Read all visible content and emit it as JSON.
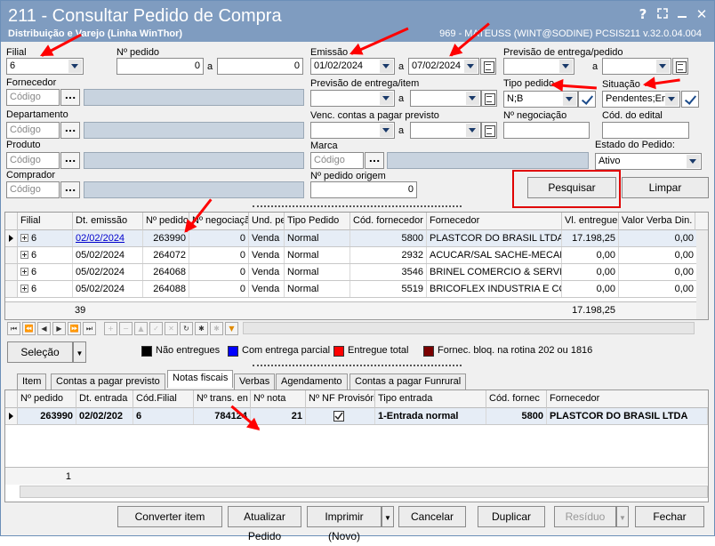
{
  "window": {
    "title": "211 - Consultar Pedido de Compra",
    "subtitle": "Distribuição e Varejo (Linha WinThor)",
    "user_info": "969 - MATEUSS (WINT@SODINE)   PCSIS211  v.32.0.04.004",
    "help_glyph": "?",
    "close_glyph": "✕"
  },
  "filters": {
    "filial_label": "Filial",
    "filial_value": "6",
    "num_pedido_label": "Nº pedido",
    "num_pedido_from": "0",
    "num_pedido_to": "0",
    "a": "a",
    "emissao_label": "Emissão",
    "emissao_from": "01/02/2024",
    "emissao_to": "07/02/2024",
    "prev_entrega_pedido_label": "Previsão de entrega/pedido",
    "fornecedor_label": "Fornecedor",
    "codigo_placeholder": "Código",
    "dots": "...",
    "prev_entrega_item_label": "Previsão de entrega/item",
    "tipo_pedido_label": "Tipo pedido",
    "tipo_pedido_value": "N;B",
    "situacao_label": "Situação",
    "situacao_value": "Pendentes;En",
    "departamento_label": "Departamento",
    "venc_label": "Venc. contas a  pagar previsto",
    "num_negociacao_label": "Nº negociação",
    "cod_edital_label": "Cód. do edital",
    "produto_label": "Produto",
    "marca_label": "Marca",
    "estado_pedido_label": "Estado do Pedido:",
    "estado_pedido_value": "Ativo",
    "comprador_label": "Comprador",
    "num_pedido_origem_label": "Nº pedido origem",
    "num_pedido_origem_value": "0",
    "pesquisar": "Pesquisar",
    "limpar": "Limpar"
  },
  "orders_grid": {
    "columns": [
      "Filial",
      "Dt. emissão",
      "Nº pedido",
      "Nº negociação",
      "Und. pe",
      "Tipo Pedido",
      "Cód. fornecedor",
      "Fornecedor",
      "Vl. entregue",
      "Valor Verba Din."
    ],
    "rows": [
      [
        "6",
        "02/02/2024",
        "263990",
        "0",
        "Venda",
        "Normal",
        "5800",
        "PLASTCOR DO BRASIL LTDA",
        "17.198,25",
        "0,00"
      ],
      [
        "6",
        "05/02/2024",
        "264072",
        "0",
        "Venda",
        "Normal",
        "2932",
        "ACUCAR/SAL SACHE-MECANO",
        "0,00",
        "0,00"
      ],
      [
        "6",
        "05/02/2024",
        "264068",
        "0",
        "Venda",
        "Normal",
        "3546",
        "BRINEL COMERCIO & SERVICO",
        "0,00",
        "0,00"
      ],
      [
        "6",
        "05/02/2024",
        "264088",
        "0",
        "Venda",
        "Normal",
        "5519",
        "BRICOFLEX INDUSTRIA E COMI",
        "0,00",
        "0,00"
      ]
    ],
    "footer_count": "39",
    "footer_total": "17.198,25"
  },
  "legend": {
    "selecao": "Seleção",
    "items": [
      {
        "label": "Não entregues",
        "color": "#000000"
      },
      {
        "label": "Com entrega parcial",
        "color": "#0000ff"
      },
      {
        "label": "Entregue total",
        "color": "#ff0000"
      },
      {
        "label": "Fornec. bloq. na rotina 202 ou 1816",
        "color": "#7a0000"
      }
    ]
  },
  "tabs": [
    "Item",
    "Contas a pagar previsto",
    "Notas fiscais",
    "Verbas",
    "Agendamento",
    "Contas a pagar Funrural"
  ],
  "nf_grid": {
    "columns": [
      "Nº pedido",
      "Dt. entrada",
      "Cód.Filial",
      "Nº trans. en",
      "Nº nota",
      "Nº NF Provisório",
      "Tipo entrada",
      "Cód. fornec",
      "Fornecedor"
    ],
    "row": [
      "263990",
      "02/02/202",
      "6",
      "784124",
      "21",
      "",
      "1-Entrada normal",
      "5800",
      "PLASTCOR DO BRASIL LTDA"
    ],
    "footer_count": "1"
  },
  "bottom_buttons": {
    "converter": "Converter item",
    "atualizar": "Atualizar Pedido",
    "imprimir": "Imprimir (Novo)",
    "cancelar": "Cancelar",
    "duplicar": "Duplicar",
    "residuo": "Resíduo",
    "fechar": "Fechar"
  }
}
